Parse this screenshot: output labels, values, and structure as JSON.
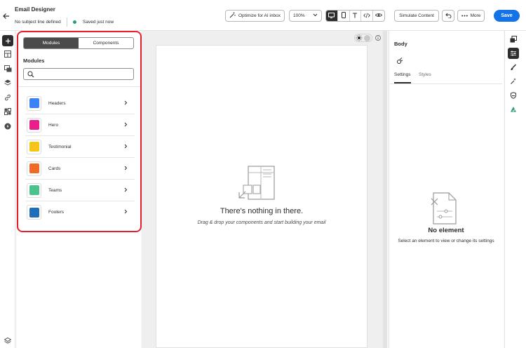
{
  "header": {
    "title": "Email Designer",
    "subject_status": "No subject line defined",
    "save_status": "Saved just now",
    "optimize_label": "Optimize for AI inbox",
    "zoom_value": "100%",
    "simulate_label": "Simulate Content",
    "more_label": "More",
    "save_label": "Save"
  },
  "modules_panel": {
    "tabs": [
      "Modules",
      "Components"
    ],
    "active_tab": "Modules",
    "title": "Modules",
    "search_placeholder": "",
    "items": [
      {
        "label": "Headers",
        "icon": "headers-icon",
        "color": "#3b82f6"
      },
      {
        "label": "Hero",
        "icon": "hero-icon",
        "color": "#e91e8c"
      },
      {
        "label": "Testimonial",
        "icon": "testimonial-icon",
        "color": "#f5c518"
      },
      {
        "label": "Cards",
        "icon": "cards-icon",
        "color": "#f06a2a"
      },
      {
        "label": "Teams",
        "icon": "teams-icon",
        "color": "#4cc38a"
      },
      {
        "label": "Footers",
        "icon": "footers-icon",
        "color": "#1e6fb8"
      }
    ]
  },
  "canvas": {
    "empty_title": "There's nothing in there.",
    "empty_subtitle": "Drag & drop your components and start building your email"
  },
  "properties": {
    "title": "Body",
    "tabs": [
      "Settings",
      "Styles"
    ],
    "active_tab": "Settings",
    "empty_title": "No element",
    "empty_subtitle": "Select an element to view or change its settings"
  },
  "colors": {
    "accent": "#1473e6",
    "highlight": "#e5202e",
    "saved_dot": "#2d9d78"
  }
}
